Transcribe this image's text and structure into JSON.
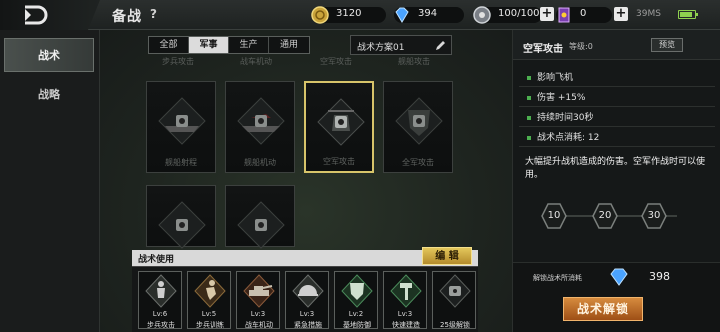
{
  "header": {
    "title": "备战",
    "help_icon": "?",
    "resources": {
      "gold": "3120",
      "gems": "394",
      "stamina": "100/100",
      "tickets": "0"
    },
    "network": "39MS"
  },
  "sidebar": {
    "items": [
      {
        "label": "战术",
        "active": true
      },
      {
        "label": "战略",
        "active": false
      }
    ]
  },
  "filters": {
    "tabs": [
      "全部",
      "军事",
      "生产",
      "通用"
    ],
    "active_index": 1,
    "plan_name": "战术方案01"
  },
  "cards_partial_labels": [
    "步兵攻击",
    "战车机动",
    "空军攻击",
    "舰船攻击"
  ],
  "cards": [
    {
      "label": "舰船射程",
      "icon": "ship-icon"
    },
    {
      "label": "舰船机动",
      "icon": "ship-icon"
    },
    {
      "label": "空军攻击",
      "icon": "helicopter-icon",
      "selected": true
    },
    {
      "label": "全军攻击",
      "icon": "shield-icon"
    },
    {
      "label": "",
      "icon": "emblem-icon"
    },
    {
      "label": "",
      "icon": "emblem-icon"
    }
  ],
  "usage": {
    "title": "战术使用",
    "edit_label": "编 辑",
    "slots": [
      {
        "level": "Lv:6",
        "name": "步兵攻击",
        "icon": "soldier-icon"
      },
      {
        "level": "Lv:5",
        "name": "步兵训练",
        "icon": "runner-icon"
      },
      {
        "level": "Lv:3",
        "name": "战车机动",
        "icon": "tank-icon"
      },
      {
        "level": "Lv:3",
        "name": "紧急措施",
        "icon": "helmet-icon"
      },
      {
        "level": "Lv:2",
        "name": "基地防御",
        "icon": "shield-icon"
      },
      {
        "level": "Lv:3",
        "name": "快速建造",
        "icon": "hammer-icon"
      },
      {
        "level": "",
        "name": "25级解锁",
        "icon": "lock-icon"
      }
    ]
  },
  "detail": {
    "title": "空军攻击",
    "level_text": "等级:0",
    "preview_label": "预览",
    "effects": [
      "影响飞机",
      "伤害 +15%",
      "持续时间30秒",
      "战术点消耗: 12"
    ],
    "description": "大幅提升战机造成的伤害。空军作战时可以使用。",
    "levels": [
      "10",
      "20",
      "30"
    ],
    "consume_label": "解锁战术所消耗",
    "consume_value": "398",
    "unlock_label": "战术解锁"
  },
  "colors": {
    "accent_gold": "#d7c46a",
    "unlock_orange": "#c0702c",
    "effect_green": "#4caf50"
  }
}
